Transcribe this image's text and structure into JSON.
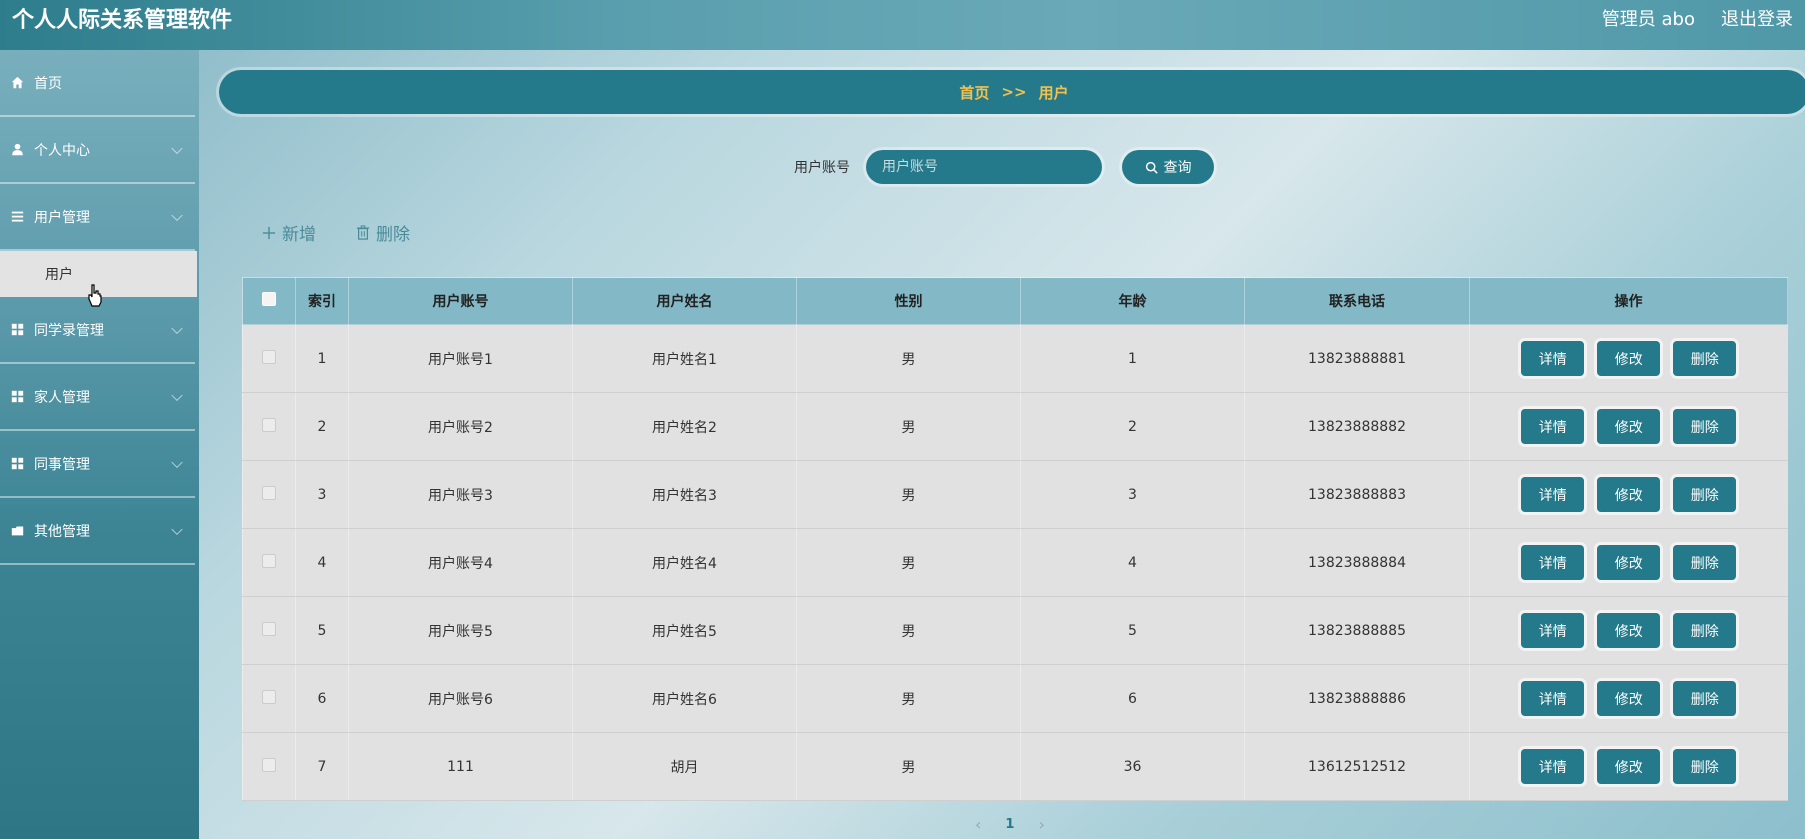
{
  "header": {
    "app_title": "个人人际关系管理软件",
    "user_label": "管理员 abo",
    "logout_label": "退出登录"
  },
  "sidebar": {
    "items": [
      {
        "label": "首页",
        "icon": "home-icon"
      },
      {
        "label": "个人中心",
        "icon": "user-icon"
      },
      {
        "label": "用户管理",
        "icon": "list-icon"
      },
      {
        "label": "同学录管理",
        "icon": "grid-icon"
      },
      {
        "label": "家人管理",
        "icon": "grid-icon"
      },
      {
        "label": "同事管理",
        "icon": "grid-icon"
      },
      {
        "label": "其他管理",
        "icon": "folder-icon"
      }
    ],
    "submenu_user": "用户"
  },
  "breadcrumb": {
    "home": "首页",
    "separator": ">>",
    "current": "用户"
  },
  "search": {
    "label": "用户账号",
    "placeholder": "用户账号",
    "button_label": "查询"
  },
  "toolbar": {
    "add_label": "新增",
    "delete_label": "删除"
  },
  "table": {
    "headers": [
      "索引",
      "用户账号",
      "用户姓名",
      "性别",
      "年龄",
      "联系电话",
      "操作"
    ],
    "rows": [
      {
        "index": "1",
        "account": "用户账号1",
        "name": "用户姓名1",
        "gender": "男",
        "age": "1",
        "phone": "13823888881"
      },
      {
        "index": "2",
        "account": "用户账号2",
        "name": "用户姓名2",
        "gender": "男",
        "age": "2",
        "phone": "13823888882"
      },
      {
        "index": "3",
        "account": "用户账号3",
        "name": "用户姓名3",
        "gender": "男",
        "age": "3",
        "phone": "13823888883"
      },
      {
        "index": "4",
        "account": "用户账号4",
        "name": "用户姓名4",
        "gender": "男",
        "age": "4",
        "phone": "13823888884"
      },
      {
        "index": "5",
        "account": "用户账号5",
        "name": "用户姓名5",
        "gender": "男",
        "age": "5",
        "phone": "13823888885"
      },
      {
        "index": "6",
        "account": "用户账号6",
        "name": "用户姓名6",
        "gender": "男",
        "age": "6",
        "phone": "13823888886"
      },
      {
        "index": "7",
        "account": "111",
        "name": "胡月",
        "gender": "男",
        "age": "36",
        "phone": "13612512512"
      }
    ],
    "row_actions": {
      "detail": "详情",
      "edit": "修改",
      "delete": "删除"
    }
  },
  "pagination": {
    "current_page": "1"
  },
  "colors": {
    "primary": "#24798a",
    "breadcrumb_text": "#f2c14e",
    "header_row": "#83b9c6"
  }
}
